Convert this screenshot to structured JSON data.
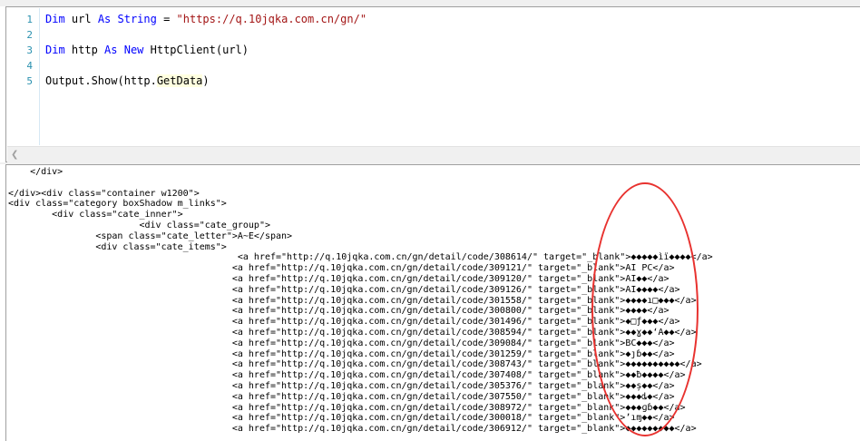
{
  "code": {
    "line_numbers": [
      "1",
      "2",
      "3",
      "4",
      "5"
    ],
    "line1": {
      "kw1": "Dim",
      "id": " url ",
      "kw2": "As",
      "kw3": " String",
      "eq": " = ",
      "str": "\"https://q.10jqka.com.cn/gn/\""
    },
    "line3": {
      "kw1": "Dim",
      "id": " http ",
      "kw2": "As",
      "kw3": " New",
      "rest": " HttpClient(url)"
    },
    "line5": {
      "pre": "Output.Show(http.",
      "hl": "GetData",
      "post": ")"
    }
  },
  "output_lines": [
    "    </div>",
    "",
    "</div><div class=\"container w1200\">",
    "<div class=\"category boxShadow m_links\">",
    "        <div class=\"cate_inner\">",
    "                        <div class=\"cate_group\">",
    "                <span class=\"cate_letter\">A~E</span>",
    "                <div class=\"cate_items\">",
    "                                          <a href=\"http://q.10jqka.com.cn/gn/detail/code/308614/\" target=\"_blank\">◆◆◆◆◆ìï◆◆◆◆</a>",
    "                                         <a href=\"http://q.10jqka.com.cn/gn/detail/code/309121/\" target=\"_blank\">AI PC</a>",
    "                                         <a href=\"http://q.10jqka.com.cn/gn/detail/code/309120/\" target=\"_blank\">AI◆◆</a>",
    "                                         <a href=\"http://q.10jqka.com.cn/gn/detail/code/309126/\" target=\"_blank\">AI◆◆◆◆</a>",
    "                                         <a href=\"http://q.10jqka.com.cn/gn/detail/code/301558/\" target=\"_blank\">◆◆◆◆ı□◆◆◆</a>",
    "                                         <a href=\"http://q.10jqka.com.cn/gn/detail/code/300800/\" target=\"_blank\">◆◆◆◆</a>",
    "                                         <a href=\"http://q.10jqka.com.cn/gn/detail/code/301496/\" target=\"_blank\">◆□ƒ◆◆◆</a>",
    "                                         <a href=\"http://q.10jqka.com.cn/gn/detail/code/308594/\" target=\"_blank\">◆◆ɣ◆◆ʻA◆◆</a>",
    "                                         <a href=\"http://q.10jqka.com.cn/gn/detail/code/309084/\" target=\"_blank\">BC◆◆◆</a>",
    "                                         <a href=\"http://q.10jqka.com.cn/gn/detail/code/301259/\" target=\"_blank\">◆ȷɓ◆◆</a>",
    "                                         <a href=\"http://q.10jqka.com.cn/gn/detail/code/308743/\" target=\"_blank\">◆◆◆◆◆◆◆◆◆◆</a>",
    "                                         <a href=\"http://q.10jqka.com.cn/gn/detail/code/307408/\" target=\"_blank\">◆◆ƀ◆◆◆◆</a>",
    "                                         <a href=\"http://q.10jqka.com.cn/gn/detail/code/305376/\" target=\"_blank\">◆◆ș◆◆</a>",
    "                                         <a href=\"http://q.10jqka.com.cn/gn/detail/code/307550/\" target=\"_blank\">◆◆◆ȡ◆</a>",
    "                                         <a href=\"http://q.10jqka.com.cn/gn/detail/code/308972/\" target=\"_blank\">◆◆◆ɡɓ◆◆</a>",
    "                                         <a href=\"http://q.10jqka.com.cn/gn/detail/code/300018/\" target=\"_blank\">ʼıɱ◆◆</a>",
    "                                         <a href=\"http://q.10jqka.com.cn/gn/detail/code/306912/\" target=\"_blank\">◆◆◆◆◆◆◆◆◆</a>"
  ],
  "annotation": {
    "color": "#e8322f",
    "shape": "ellipse"
  }
}
